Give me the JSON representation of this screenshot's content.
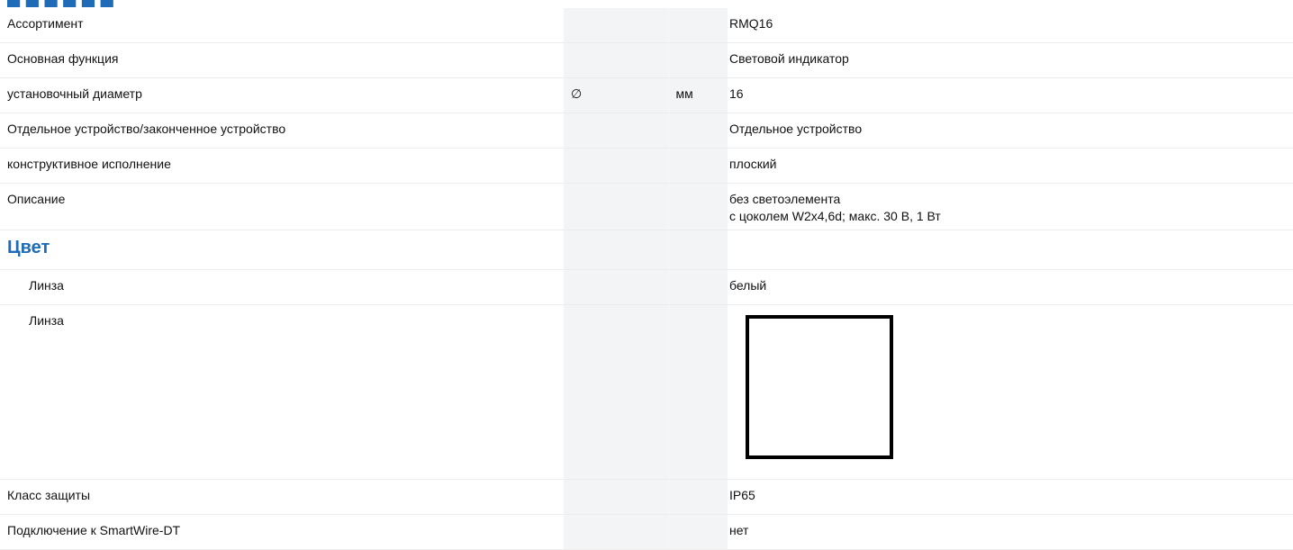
{
  "rows": [
    {
      "label": "Ассортимент",
      "symbol": "",
      "unit": "",
      "value": "RMQ16"
    },
    {
      "label": "Основная функция",
      "symbol": "",
      "unit": "",
      "value": "Световой индикатор"
    },
    {
      "label": "установочный диаметр",
      "symbol": "∅",
      "unit": "мм",
      "value": "16"
    },
    {
      "label": "Отдельное устройство/законченное устройство",
      "symbol": "",
      "unit": "",
      "value": "Отдельное устройство"
    },
    {
      "label": "конструктивное исполнение",
      "symbol": "",
      "unit": "",
      "value": "плоский"
    },
    {
      "label": "Описание",
      "symbol": "",
      "unit": "",
      "value_lines": [
        "без светоэлемента",
        "с цоколем W2x4,6d; макс. 30 В, 1 Вт"
      ]
    }
  ],
  "color_section": {
    "title": "Цвет",
    "rows": [
      {
        "label": "Линза",
        "value": "белый"
      },
      {
        "label": "Линза",
        "swatch_color": "#ffffff",
        "swatch_border": "#000000"
      }
    ]
  },
  "rows_after": [
    {
      "label": "Класс защиты",
      "value": "IP65"
    },
    {
      "label": "Подключение к SmartWire-DT",
      "value": "нет"
    }
  ],
  "colors": {
    "accent": "#1f6bb8",
    "shaded_column": "#f2f4f6",
    "row_divider": "#ececec"
  }
}
